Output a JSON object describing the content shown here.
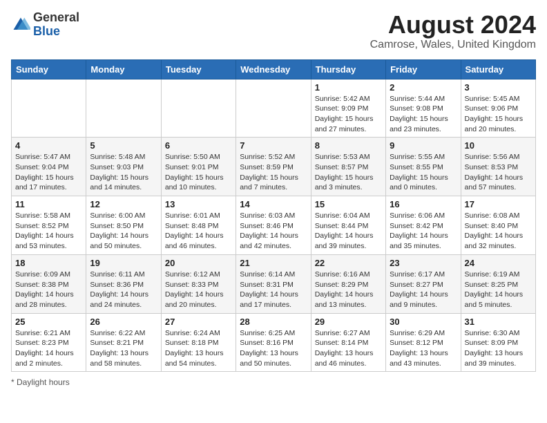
{
  "logo": {
    "general": "General",
    "blue": "Blue"
  },
  "title": "August 2024",
  "subtitle": "Camrose, Wales, United Kingdom",
  "days_of_week": [
    "Sunday",
    "Monday",
    "Tuesday",
    "Wednesday",
    "Thursday",
    "Friday",
    "Saturday"
  ],
  "weeks": [
    [
      {
        "day": "",
        "info": ""
      },
      {
        "day": "",
        "info": ""
      },
      {
        "day": "",
        "info": ""
      },
      {
        "day": "",
        "info": ""
      },
      {
        "day": "1",
        "info": "Sunrise: 5:42 AM\nSunset: 9:09 PM\nDaylight: 15 hours and 27 minutes."
      },
      {
        "day": "2",
        "info": "Sunrise: 5:44 AM\nSunset: 9:08 PM\nDaylight: 15 hours and 23 minutes."
      },
      {
        "day": "3",
        "info": "Sunrise: 5:45 AM\nSunset: 9:06 PM\nDaylight: 15 hours and 20 minutes."
      }
    ],
    [
      {
        "day": "4",
        "info": "Sunrise: 5:47 AM\nSunset: 9:04 PM\nDaylight: 15 hours and 17 minutes."
      },
      {
        "day": "5",
        "info": "Sunrise: 5:48 AM\nSunset: 9:03 PM\nDaylight: 15 hours and 14 minutes."
      },
      {
        "day": "6",
        "info": "Sunrise: 5:50 AM\nSunset: 9:01 PM\nDaylight: 15 hours and 10 minutes."
      },
      {
        "day": "7",
        "info": "Sunrise: 5:52 AM\nSunset: 8:59 PM\nDaylight: 15 hours and 7 minutes."
      },
      {
        "day": "8",
        "info": "Sunrise: 5:53 AM\nSunset: 8:57 PM\nDaylight: 15 hours and 3 minutes."
      },
      {
        "day": "9",
        "info": "Sunrise: 5:55 AM\nSunset: 8:55 PM\nDaylight: 15 hours and 0 minutes."
      },
      {
        "day": "10",
        "info": "Sunrise: 5:56 AM\nSunset: 8:53 PM\nDaylight: 14 hours and 57 minutes."
      }
    ],
    [
      {
        "day": "11",
        "info": "Sunrise: 5:58 AM\nSunset: 8:52 PM\nDaylight: 14 hours and 53 minutes."
      },
      {
        "day": "12",
        "info": "Sunrise: 6:00 AM\nSunset: 8:50 PM\nDaylight: 14 hours and 50 minutes."
      },
      {
        "day": "13",
        "info": "Sunrise: 6:01 AM\nSunset: 8:48 PM\nDaylight: 14 hours and 46 minutes."
      },
      {
        "day": "14",
        "info": "Sunrise: 6:03 AM\nSunset: 8:46 PM\nDaylight: 14 hours and 42 minutes."
      },
      {
        "day": "15",
        "info": "Sunrise: 6:04 AM\nSunset: 8:44 PM\nDaylight: 14 hours and 39 minutes."
      },
      {
        "day": "16",
        "info": "Sunrise: 6:06 AM\nSunset: 8:42 PM\nDaylight: 14 hours and 35 minutes."
      },
      {
        "day": "17",
        "info": "Sunrise: 6:08 AM\nSunset: 8:40 PM\nDaylight: 14 hours and 32 minutes."
      }
    ],
    [
      {
        "day": "18",
        "info": "Sunrise: 6:09 AM\nSunset: 8:38 PM\nDaylight: 14 hours and 28 minutes."
      },
      {
        "day": "19",
        "info": "Sunrise: 6:11 AM\nSunset: 8:36 PM\nDaylight: 14 hours and 24 minutes."
      },
      {
        "day": "20",
        "info": "Sunrise: 6:12 AM\nSunset: 8:33 PM\nDaylight: 14 hours and 20 minutes."
      },
      {
        "day": "21",
        "info": "Sunrise: 6:14 AM\nSunset: 8:31 PM\nDaylight: 14 hours and 17 minutes."
      },
      {
        "day": "22",
        "info": "Sunrise: 6:16 AM\nSunset: 8:29 PM\nDaylight: 14 hours and 13 minutes."
      },
      {
        "day": "23",
        "info": "Sunrise: 6:17 AM\nSunset: 8:27 PM\nDaylight: 14 hours and 9 minutes."
      },
      {
        "day": "24",
        "info": "Sunrise: 6:19 AM\nSunset: 8:25 PM\nDaylight: 14 hours and 5 minutes."
      }
    ],
    [
      {
        "day": "25",
        "info": "Sunrise: 6:21 AM\nSunset: 8:23 PM\nDaylight: 14 hours and 2 minutes."
      },
      {
        "day": "26",
        "info": "Sunrise: 6:22 AM\nSunset: 8:21 PM\nDaylight: 13 hours and 58 minutes."
      },
      {
        "day": "27",
        "info": "Sunrise: 6:24 AM\nSunset: 8:18 PM\nDaylight: 13 hours and 54 minutes."
      },
      {
        "day": "28",
        "info": "Sunrise: 6:25 AM\nSunset: 8:16 PM\nDaylight: 13 hours and 50 minutes."
      },
      {
        "day": "29",
        "info": "Sunrise: 6:27 AM\nSunset: 8:14 PM\nDaylight: 13 hours and 46 minutes."
      },
      {
        "day": "30",
        "info": "Sunrise: 6:29 AM\nSunset: 8:12 PM\nDaylight: 13 hours and 43 minutes."
      },
      {
        "day": "31",
        "info": "Sunrise: 6:30 AM\nSunset: 8:09 PM\nDaylight: 13 hours and 39 minutes."
      }
    ]
  ],
  "footer": "* Daylight hours"
}
